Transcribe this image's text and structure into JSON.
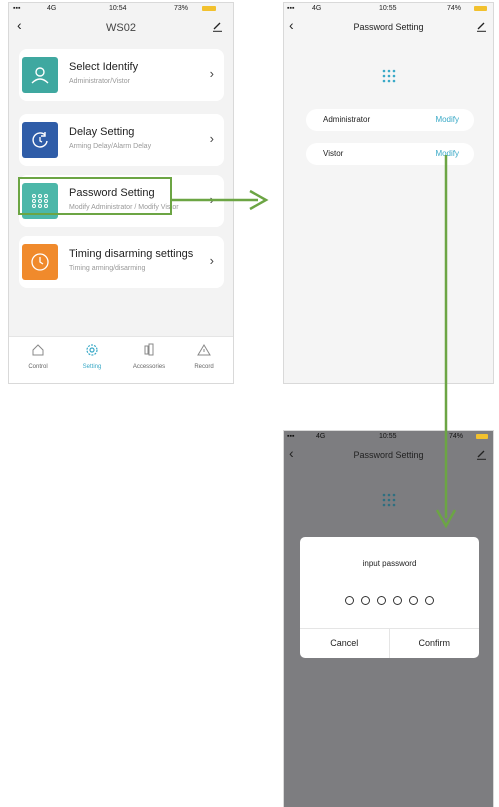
{
  "phone1": {
    "status": {
      "carrier": "4G",
      "time": "10:54",
      "battery": "73%"
    },
    "title": "WS02",
    "cards": [
      {
        "title": "Select Identify",
        "subtitle": "Administrator/Vistor",
        "color": "#3fa8a0",
        "icon": "user-icon"
      },
      {
        "title": "Delay Setting",
        "subtitle": "Arming Delay/Alarm Delay",
        "color": "#2f5da8",
        "icon": "timer-icon"
      },
      {
        "title": "Password Setting",
        "subtitle": "Modify Administrator / Modify Vistor",
        "color": "#4cb7a9",
        "icon": "keypad-icon"
      },
      {
        "title": "Timing disarming settings",
        "subtitle": "Timing arming/disarming",
        "color": "#f08a2c",
        "icon": "clock-icon"
      }
    ],
    "tabs": [
      {
        "label": "Control",
        "icon": "home-icon"
      },
      {
        "label": "Setting",
        "icon": "gear-icon",
        "active": true
      },
      {
        "label": "Accessories",
        "icon": "sensor-icon"
      },
      {
        "label": "Record",
        "icon": "warning-icon"
      }
    ]
  },
  "phone2": {
    "status": {
      "carrier": "4G",
      "time": "10:55",
      "battery": "74%"
    },
    "title": "Password Setting",
    "rows": [
      {
        "label": "Administrator",
        "action": "Modify"
      },
      {
        "label": "Vistor",
        "action": "Modify"
      }
    ]
  },
  "phone3": {
    "status": {
      "carrier": "4G",
      "time": "10:55",
      "battery": "74%"
    },
    "title": "Password Setting",
    "dialog": {
      "title": "input password",
      "cancel": "Cancel",
      "confirm": "Confirm",
      "digits": 6
    }
  },
  "colors": {
    "accent": "#39a9c7",
    "annotation": "#6ca544"
  }
}
